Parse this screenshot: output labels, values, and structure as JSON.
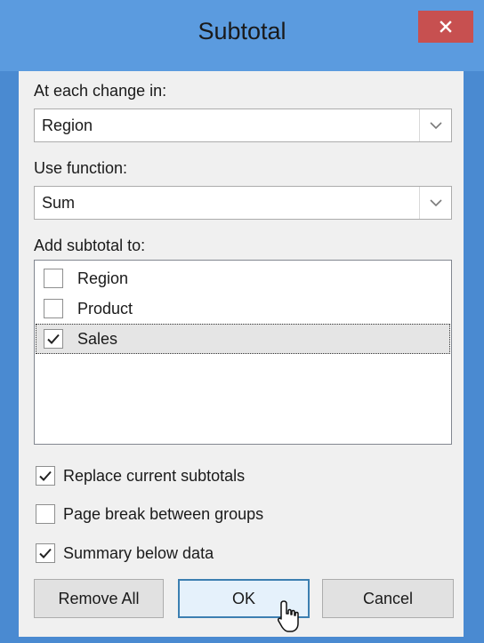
{
  "dialog": {
    "title": "Subtotal",
    "close_icon": "close-icon",
    "accent_color": "#5b9bdf",
    "close_color": "#c75050"
  },
  "change_in": {
    "label": "At each change in:",
    "value": "Region"
  },
  "function": {
    "label": "Use function:",
    "value": "Sum"
  },
  "add_subtotal": {
    "label": "Add subtotal to:",
    "items": [
      {
        "label": "Region",
        "checked": false
      },
      {
        "label": "Product",
        "checked": false
      },
      {
        "label": "Sales",
        "checked": true
      }
    ]
  },
  "options": [
    {
      "label": "Replace current subtotals",
      "checked": true
    },
    {
      "label": "Page break between groups",
      "checked": false
    },
    {
      "label": "Summary below data",
      "checked": true
    }
  ],
  "buttons": {
    "remove_all": "Remove All",
    "ok": "OK",
    "cancel": "Cancel"
  }
}
